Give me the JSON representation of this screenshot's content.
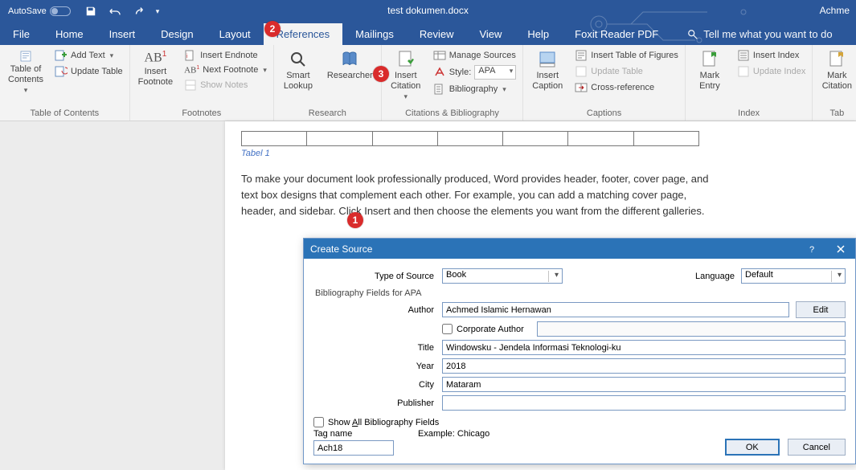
{
  "titlebar": {
    "autosave": "AutoSave",
    "doc": "test dokumen.docx",
    "user": "Achme"
  },
  "tabs": {
    "file": "File",
    "home": "Home",
    "insert": "Insert",
    "design": "Design",
    "layout": "Layout",
    "references": "References",
    "mailings": "Mailings",
    "review": "Review",
    "view": "View",
    "help": "Help",
    "foxit": "Foxit Reader PDF",
    "tellme": "Tell me what you want to do"
  },
  "ribbon": {
    "toc": {
      "big": "Table of\nContents",
      "addtext": "Add Text",
      "update": "Update Table",
      "group": "Table of Contents"
    },
    "footnotes": {
      "big": "Insert\nFootnote",
      "endnote": "Insert Endnote",
      "next": "Next Footnote",
      "show": "Show Notes",
      "group": "Footnotes"
    },
    "research": {
      "smart": "Smart\nLookup",
      "researcher": "Researcher",
      "group": "Research"
    },
    "citations": {
      "insert": "Insert\nCitation",
      "manage": "Manage Sources",
      "style_lbl": "Style:",
      "style_val": "APA",
      "biblio": "Bibliography",
      "group": "Citations & Bibliography"
    },
    "captions": {
      "big": "Insert\nCaption",
      "tof": "Insert Table of Figures",
      "update": "Update Table",
      "cross": "Cross-reference",
      "group": "Captions"
    },
    "index": {
      "big": "Mark\nEntry",
      "insert": "Insert Index",
      "update": "Update Index",
      "group": "Index"
    },
    "authorities": {
      "big": "Mark\nCitation",
      "group": "Tab"
    }
  },
  "doc": {
    "caption": "Tabel 1",
    "para": "To make your document look professionally produced, Word provides header, footer, cover page, and text box designs that complement each other. For example, you can add a matching cover page, header, and sidebar. Click Insert and then choose the elements you want from the different galleries."
  },
  "dialog": {
    "title": "Create Source",
    "type_lbl": "Type of Source",
    "type_val": "Book",
    "lang_lbl": "Language",
    "lang_val": "Default",
    "section": "Bibliography Fields for APA",
    "author_lbl": "Author",
    "author_val": "Achmed Islamic Hernawan",
    "edit": "Edit",
    "corp": "Corporate Author",
    "title_lbl": "Title",
    "title_val": "Windowsku - Jendela Informasi Teknologi-ku",
    "year_lbl": "Year",
    "year_val": "2018",
    "city_lbl": "City",
    "city_val": "Mataram",
    "publisher_lbl": "Publisher",
    "publisher_val": "",
    "showall_pre": "Show ",
    "showall_u": "A",
    "showall_post": "ll Bibliography Fields",
    "tagname_lbl": "Tag name",
    "tagname_val": "Ach18",
    "example": "Example: Chicago",
    "ok": "OK",
    "cancel": "Cancel"
  },
  "annot": {
    "n1": "1",
    "n2": "2",
    "n3": "3"
  }
}
